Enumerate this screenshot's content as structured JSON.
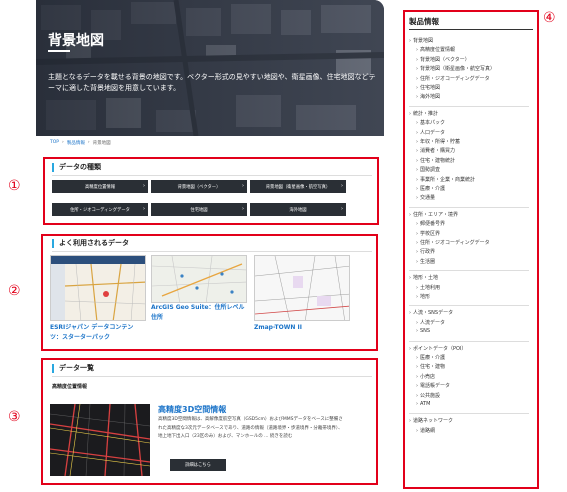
{
  "hero": {
    "title": "背景地図",
    "description": "主題となるデータを載せる背景の地図です。ベクター形式の見やすい地図や、衛星画像、住宅地図などテーマに適した背景地図を用意しています。"
  },
  "breadcrumb": [
    "TOP",
    "製品情報",
    "背景地図"
  ],
  "annotations": [
    "①",
    "②",
    "③",
    "④"
  ],
  "section1": {
    "title": "データの種類",
    "buttons": [
      "高精度位置情報",
      "背景地図（ベクター）",
      "背景地図（衛星画像・航空写真）",
      "住所・ジオコーディングデータ",
      "住宅地図",
      "海外地図"
    ]
  },
  "section2": {
    "title": "よく利用されるデータ",
    "items": [
      {
        "line1": "ESRIジャパン データコンテン",
        "line2": "ツ：スターターパック"
      },
      {
        "line1": "ArcGIS Geo Suite：住所レベル",
        "line2": "住所"
      },
      {
        "line1": "Zmap-TOWN II",
        "line2": ""
      }
    ]
  },
  "section3": {
    "title": "データ一覧",
    "sublabel": "高精度位置情報",
    "product_title": "高精度3D空間情報",
    "product_desc": "高精度3D空間情報は、高解像度航空写真（GSD5cm）およびMMSデータをベースに整備された高精度な3次元データベースであり、道路の情報（道路境界・歩道境界・分離帯境界）、地上地下出入口（23区のみ）および、マンホールの ... 続きを読む",
    "detail_button": "詳細はこちら"
  },
  "sidebar": {
    "title": "製品情報",
    "groups": [
      {
        "head": "背景地図",
        "items": [
          "高精度位置情報",
          "背景地図（ベクター）",
          "背景地図（衛星画像・航空写真）",
          "住所・ジオコーディングデータ",
          "住宅地図",
          "海外地図"
        ]
      },
      {
        "head": "統計・推計",
        "items": [
          "基本パック",
          "人口データ",
          "年収・所得・貯蓄",
          "消費者・購買力",
          "住宅・建物統計",
          "国勢調査",
          "事業所・企業・商業統計",
          "医療・介護",
          "交通量"
        ]
      },
      {
        "head": "住所・エリア・境界",
        "items": [
          "郵便番号界",
          "学校区界",
          "住所・ジオコーディングデータ",
          "行政界",
          "生活圏"
        ]
      },
      {
        "head": "地形・土地",
        "items": [
          "土地利用",
          "地形"
        ]
      },
      {
        "head": "人流・SNSデータ",
        "items": [
          "人流データ",
          "SNS"
        ]
      },
      {
        "head": "ポイントデータ（POI）",
        "items": [
          "医療・介護",
          "住宅・建物",
          "小売店",
          "電話帳データ",
          "公共施設",
          "ATM"
        ]
      },
      {
        "head": "道路ネットワーク",
        "items": [
          "道路網"
        ]
      }
    ]
  },
  "colors": {
    "annotation": "#e2001a",
    "accent": "#29a8e0",
    "link": "#1a73c8",
    "button": "#2a2f35"
  }
}
